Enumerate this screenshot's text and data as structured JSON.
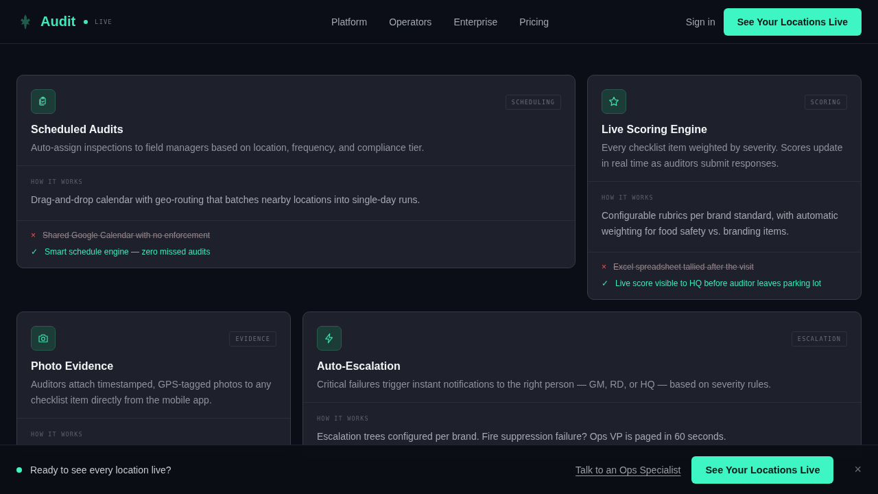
{
  "header": {
    "brand": "Audit",
    "live_label": "LIVE",
    "nav": [
      "Platform",
      "Operators",
      "Enterprise",
      "Pricing"
    ],
    "sign_in": "Sign in",
    "cta": "See Your Locations Live"
  },
  "rows": [
    {
      "cards": [
        {
          "kind": "clipboards",
          "tag": "SCHEDULING",
          "title": "Scheduled Audits",
          "description": "Auto-assign inspections to field managers based on location, frequency, and compliance tier.",
          "how_label": "HOW IT WORKS",
          "how_text": "Drag-and-drop calendar with geo-routing that batches nearby locations into single-day runs.",
          "comparison": [
            {
              "kind": "before",
              "mark": "×",
              "text": "Shared Google Calendar with no enforcement"
            },
            {
              "kind": "after",
              "mark": "✓",
              "text": "Smart schedule engine — zero missed audits"
            }
          ]
        },
        {
          "kind": "star",
          "tag": "SCORING",
          "title": "Live Scoring Engine",
          "description": "Every checklist item weighted by severity. Scores update in real time as auditors submit responses.",
          "how_label": "HOW IT WORKS",
          "how_text": "Configurable rubrics per brand standard, with automatic weighting for food safety vs. branding items.",
          "comparison": [
            {
              "kind": "before",
              "mark": "×",
              "text": "Excel spreadsheet tallied after the visit"
            },
            {
              "kind": "after",
              "mark": "✓",
              "text": "Live score visible to HQ before auditor leaves parking lot"
            }
          ]
        }
      ]
    },
    {
      "cards": [
        {
          "kind": "camera",
          "tag": "EVIDENCE",
          "title": "Photo Evidence",
          "description": "Auditors attach timestamped, GPS-tagged photos to any checklist item directly from the mobile app.",
          "how_label": "HOW IT WORKS"
        },
        {
          "kind": "bolt",
          "tag": "ESCALATION",
          "title": "Auto-Escalation",
          "description": "Critical failures trigger instant notifications to the right person — GM, RD, or HQ — based on severity rules.",
          "how_label": "HOW IT WORKS",
          "how_text": "Escalation trees configured per brand. Fire suppression failure? Ops VP is paged in 60 seconds."
        }
      ]
    }
  ],
  "bottom_bar": {
    "message": "Ready to see every location live?",
    "link": "Talk to an Ops Specialist",
    "cta": "See Your Locations Live",
    "close": "×"
  }
}
